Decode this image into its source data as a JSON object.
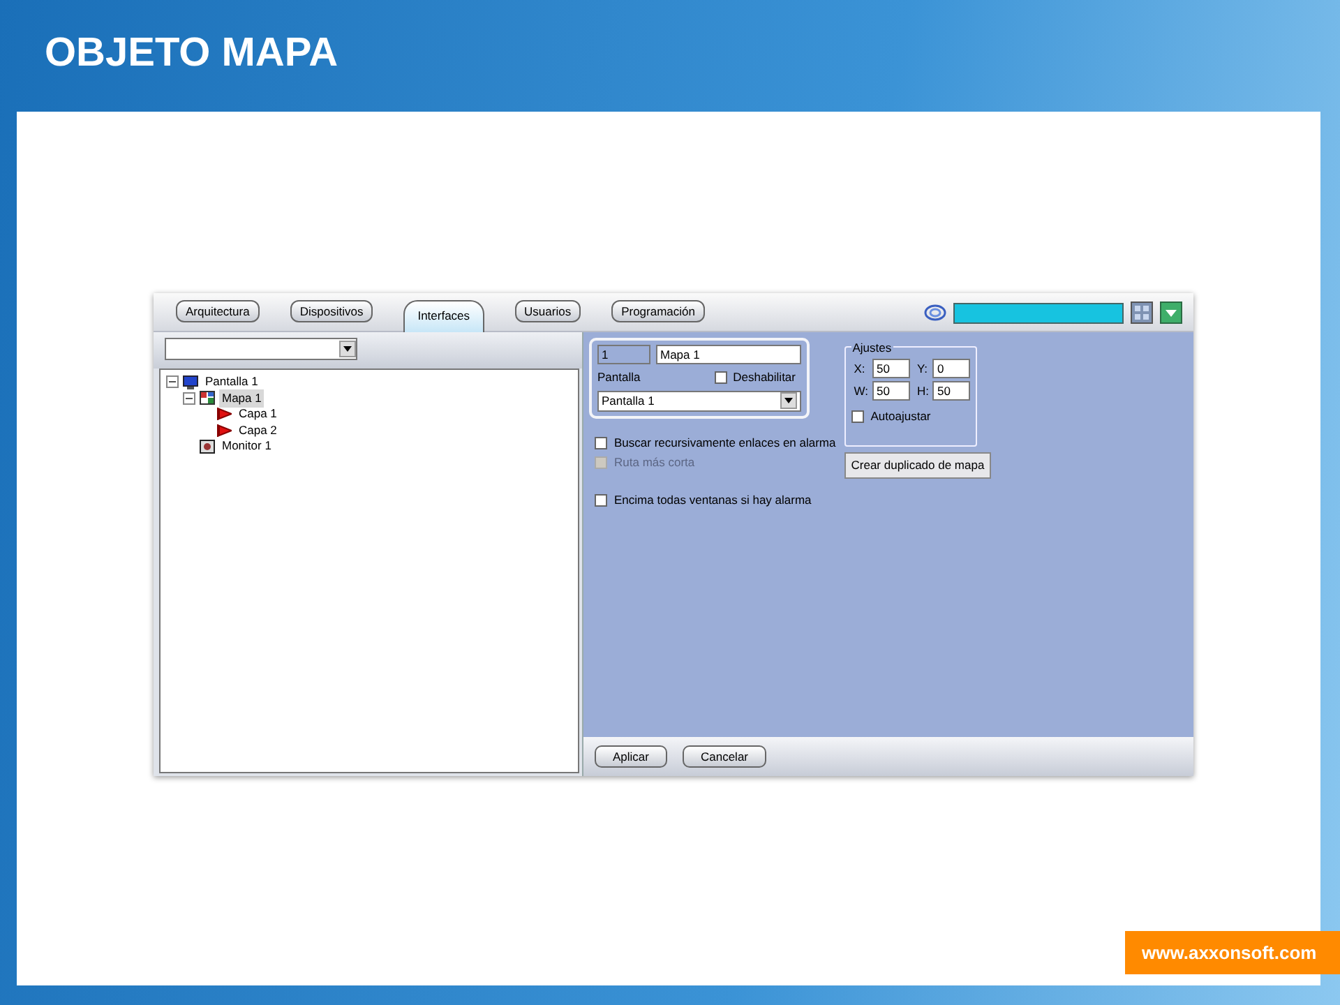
{
  "slide": {
    "title": "OBJETO MAPA",
    "footer_url": "www.axxonsoft.com"
  },
  "tabs": [
    {
      "label": "Arquitectura",
      "selected": false
    },
    {
      "label": "Dispositivos",
      "selected": false
    },
    {
      "label": "Interfaces",
      "selected": true
    },
    {
      "label": "Usuarios",
      "selected": false
    },
    {
      "label": "Programación",
      "selected": false
    }
  ],
  "tree": [
    {
      "label": "Pantalla 1",
      "kind": "screen",
      "expanded": true,
      "selected": false,
      "children": [
        {
          "label": "Mapa 1",
          "kind": "map",
          "expanded": true,
          "selected": true,
          "children": [
            {
              "label": "Capa 1",
              "kind": "layer",
              "selected": false
            },
            {
              "label": "Capa 2",
              "kind": "layer",
              "selected": false
            }
          ]
        },
        {
          "label": "Monitor 1",
          "kind": "monitor",
          "selected": false
        }
      ]
    }
  ],
  "properties": {
    "id": "1",
    "name": "Mapa 1",
    "screen_label": "Pantalla",
    "screen_value": "Pantalla 1",
    "disable": {
      "label": "Deshabilitar",
      "checked": false
    }
  },
  "adjust": {
    "title": "Ajustes",
    "fields": [
      {
        "label": "X:",
        "value": "50"
      },
      {
        "label": "Y:",
        "value": "0"
      },
      {
        "label": "W:",
        "value": "50"
      },
      {
        "label": "H:",
        "value": "50"
      }
    ],
    "autofit": {
      "label": "Autoajustar",
      "checked": false
    }
  },
  "options": [
    {
      "label": "Buscar recursivamente enlaces en alarma",
      "checked": false,
      "disabled": false
    },
    {
      "label": "Ruta más corta",
      "checked": false,
      "disabled": true
    },
    {
      "label": "Encima todas ventanas si hay alarma",
      "checked": false,
      "disabled": false
    }
  ],
  "duplicate_button": "Crear duplicado de mapa",
  "footer_buttons": [
    "Aplicar",
    "Cancelar"
  ]
}
